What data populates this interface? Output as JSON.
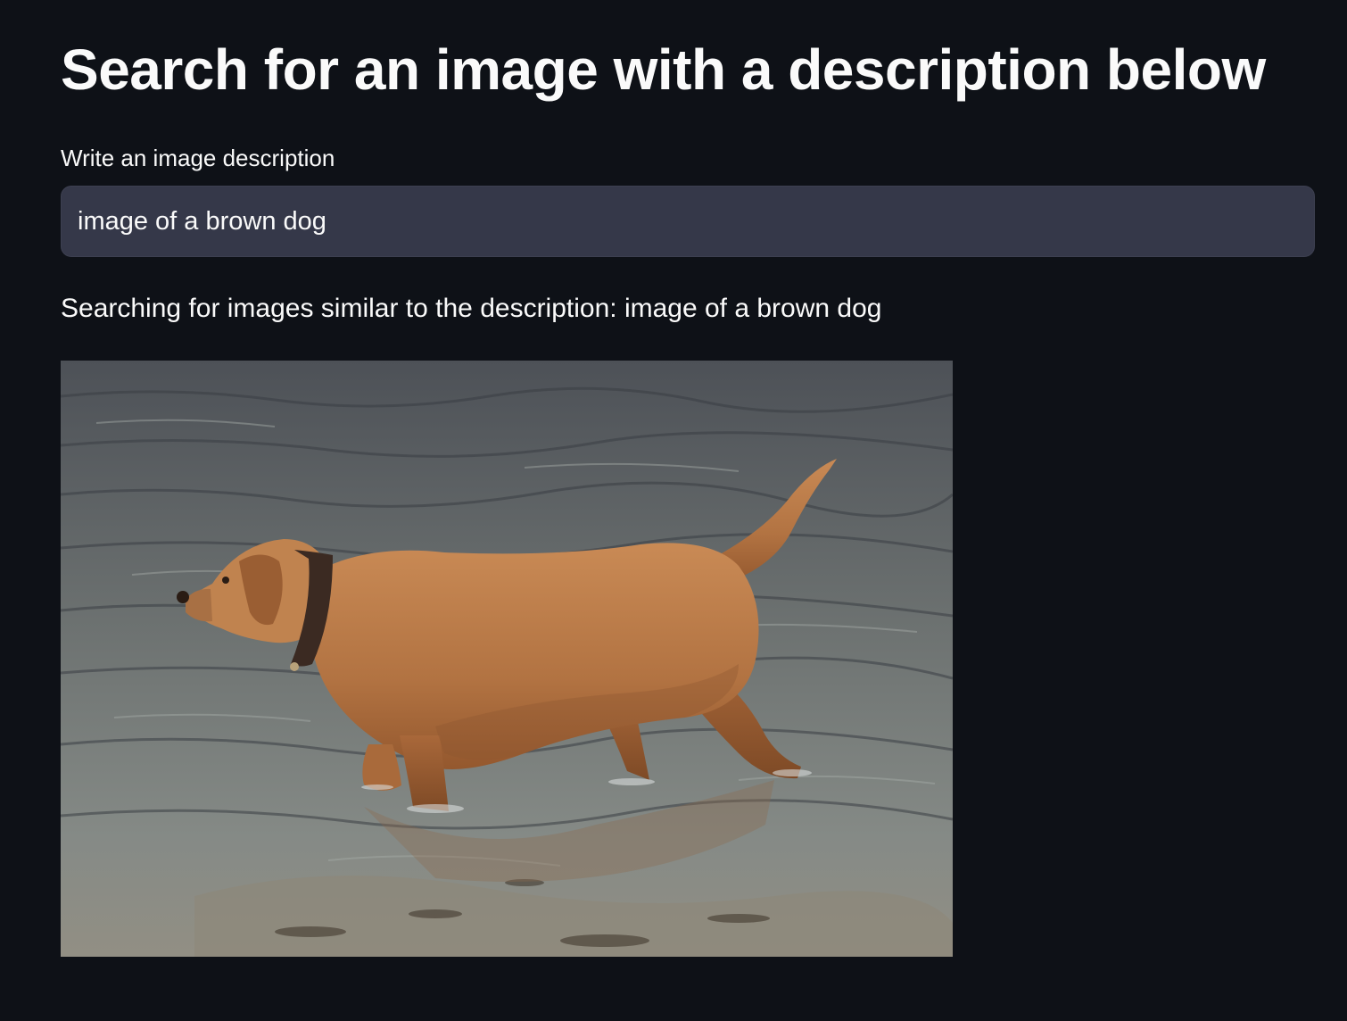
{
  "page": {
    "title": "Search for an image with a description below"
  },
  "search": {
    "label": "Write an image description",
    "value": "image of a brown dog"
  },
  "status": {
    "text": "Searching for images similar to the description: image of a brown dog"
  },
  "result": {
    "image_subject": "brown dog wading in water"
  },
  "colors": {
    "background": "#0e1117",
    "input_background": "#353849",
    "text": "#fafafa"
  }
}
